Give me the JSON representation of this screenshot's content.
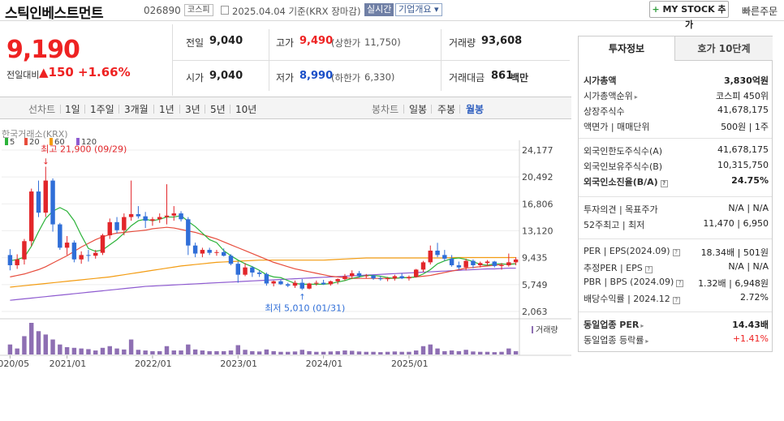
{
  "header": {
    "company_name": "스틱인베스트먼트",
    "code": "026890",
    "market": "코스피",
    "date_text": "2025.04.04 기준(KRX 장마감)",
    "realtime_label": "실시간",
    "corp_overview_label": "기업개요 ▾",
    "mystock_label": "MY STOCK 추가",
    "quick_order_label": "빠른주문"
  },
  "price": {
    "current": "9,190",
    "change_label": "전일대비",
    "change_value": "▲150",
    "change_pct": "+1.66%"
  },
  "quote": {
    "prev_close_label": "전일",
    "prev_close": "9,040",
    "high_label": "고가",
    "high": "9,490",
    "high_limit_label": "(상한가",
    "high_limit": "11,750)",
    "volume_label": "거래량",
    "volume": "93,608",
    "open_label": "시가",
    "open": "9,040",
    "low_label": "저가",
    "low": "8,990",
    "low_limit_label": "(하한가",
    "low_limit": "6,330)",
    "amount_label": "거래대금",
    "amount": "861",
    "amount_unit": "백만"
  },
  "toolbar": {
    "line_chart": "선차트",
    "ranges": [
      "1일",
      "1주일",
      "3개월",
      "1년",
      "3년",
      "5년",
      "10년"
    ],
    "candle_chart": "봉차트",
    "candle_periods": [
      "일봉",
      "주봉",
      "월봉"
    ],
    "active_period": "월봉"
  },
  "chart_data": {
    "type": "candlestick",
    "source_label": "한국거래소(KRX)",
    "moving_averages": [
      {
        "name": "5",
        "color": "#2db33a"
      },
      {
        "name": "20",
        "color": "#e74c3c"
      },
      {
        "name": "60",
        "color": "#f39c12"
      },
      {
        "name": "120",
        "color": "#8e5bd0"
      }
    ],
    "y_ticks": [
      "24,177",
      "20,492",
      "16,806",
      "13,120",
      "9,435",
      "5,749",
      "2,063"
    ],
    "ylim": [
      2063,
      24177
    ],
    "x_ticks": [
      "2020/05",
      "2021/01",
      "2022/01",
      "2023/01",
      "2024/01",
      "2025/01"
    ],
    "volume_label": "거래량",
    "annotation_high": "최고 21,900 (09/29)",
    "annotation_low": "최저 5,010 (01/31)",
    "ohlc": [
      [
        9800,
        10600,
        7700,
        8400
      ],
      [
        8400,
        9900,
        7900,
        9200
      ],
      [
        9200,
        12000,
        8500,
        11700
      ],
      [
        11700,
        18900,
        11000,
        18500
      ],
      [
        18500,
        20000,
        15000,
        15600
      ],
      [
        15600,
        21900,
        15000,
        20000
      ],
      [
        20000,
        20300,
        13000,
        14000
      ],
      [
        14000,
        14200,
        10500,
        10800
      ],
      [
        10800,
        12400,
        9800,
        11500
      ],
      [
        11500,
        11800,
        8800,
        9200
      ],
      [
        9200,
        10300,
        8600,
        9800
      ],
      [
        9800,
        10500,
        8900,
        9700
      ],
      [
        9700,
        10500,
        9300,
        10100
      ],
      [
        10100,
        12700,
        9800,
        12500
      ],
      [
        12500,
        14800,
        12000,
        14300
      ],
      [
        14300,
        15000,
        12800,
        13200
      ],
      [
        13200,
        15500,
        12500,
        15000
      ],
      [
        15000,
        20000,
        14500,
        15400
      ],
      [
        15400,
        16500,
        14800,
        15100
      ],
      [
        15100,
        15700,
        13500,
        14500
      ],
      [
        14500,
        15000,
        13800,
        14700
      ],
      [
        14700,
        15500,
        14200,
        15000
      ],
      [
        15000,
        19500,
        14000,
        15200
      ],
      [
        15200,
        16500,
        14500,
        15500
      ],
      [
        15500,
        15800,
        14400,
        14700
      ],
      [
        14700,
        15000,
        9800,
        11100
      ],
      [
        11100,
        11500,
        9500,
        10000
      ],
      [
        10000,
        10800,
        9500,
        10500
      ],
      [
        10500,
        10800,
        9800,
        10100
      ],
      [
        10100,
        10500,
        9700,
        10200
      ],
      [
        10200,
        10700,
        9600,
        9700
      ],
      [
        9700,
        9900,
        8400,
        8600
      ],
      [
        8600,
        8900,
        6000,
        7100
      ],
      [
        7100,
        8700,
        6900,
        8100
      ],
      [
        8100,
        8300,
        6800,
        7400
      ],
      [
        7400,
        7700,
        6800,
        7200
      ],
      [
        7200,
        7400,
        5600,
        5900
      ],
      [
        5900,
        6300,
        5500,
        6200
      ],
      [
        6200,
        6400,
        5700,
        5800
      ],
      [
        5800,
        6000,
        5400,
        5600
      ],
      [
        5600,
        6300,
        5300,
        6000
      ],
      [
        6000,
        6500,
        5010,
        5200
      ],
      [
        5200,
        6000,
        5100,
        5900
      ],
      [
        5900,
        6300,
        5600,
        6000
      ],
      [
        6000,
        6400,
        5700,
        5800
      ],
      [
        5800,
        6300,
        5600,
        6200
      ],
      [
        6200,
        6600,
        5800,
        6500
      ],
      [
        6500,
        7200,
        6300,
        6900
      ],
      [
        6900,
        7700,
        6500,
        7300
      ],
      [
        7300,
        7600,
        6700,
        6900
      ],
      [
        6900,
        7200,
        6600,
        7000
      ],
      [
        7000,
        7100,
        6400,
        6600
      ],
      [
        6600,
        6900,
        6300,
        6500
      ],
      [
        6500,
        6800,
        6200,
        6600
      ],
      [
        6600,
        7100,
        6300,
        6900
      ],
      [
        6900,
        7300,
        6500,
        6600
      ],
      [
        6600,
        7000,
        6300,
        6800
      ],
      [
        6800,
        7900,
        6700,
        7800
      ],
      [
        7800,
        9000,
        7500,
        8800
      ],
      [
        8800,
        11100,
        8500,
        10400
      ],
      [
        10400,
        11470,
        9500,
        9800
      ],
      [
        9800,
        10500,
        9000,
        9300
      ],
      [
        9300,
        9800,
        8200,
        8400
      ],
      [
        8400,
        8900,
        7800,
        8100
      ],
      [
        8100,
        9300,
        7700,
        9000
      ],
      [
        9000,
        9200,
        8000,
        8400
      ],
      [
        8400,
        8900,
        8100,
        8700
      ],
      [
        8700,
        9100,
        8300,
        8900
      ],
      [
        8900,
        9000,
        8100,
        8300
      ],
      [
        8300,
        8700,
        7800,
        8400
      ],
      [
        8400,
        10000,
        8200,
        8800
      ],
      [
        8800,
        9490,
        8400,
        9190
      ]
    ],
    "ma5": [
      9000,
      9200,
      9500,
      11000,
      13000,
      14800,
      15800,
      16300,
      15800,
      14500,
      12500,
      10700,
      10300,
      10500,
      11200,
      11900,
      12800,
      13800,
      14500,
      14700,
      14500,
      14700,
      15000,
      15000,
      15200,
      14400,
      13700,
      12800,
      11900,
      11500,
      10400,
      9700,
      9100,
      8600,
      8200,
      7700,
      7100,
      6800,
      6700,
      6300,
      5900,
      5800,
      5800,
      5800,
      5800,
      5900,
      6100,
      6300,
      6600,
      6800,
      7000,
      7000,
      6900,
      6700,
      6600,
      6700,
      6700,
      6800,
      7200,
      7800,
      8600,
      9000,
      9300,
      9400,
      9200,
      8900,
      8500,
      8400,
      8600,
      8600,
      8500,
      8600
    ],
    "ma20": [
      6800,
      7000,
      7200,
      7500,
      7800,
      8200,
      8700,
      9200,
      9700,
      10300,
      10900,
      11400,
      11900,
      12300,
      12600,
      12800,
      12900,
      13000,
      13100,
      13200,
      13400,
      13500,
      13600,
      13500,
      13300,
      13100,
      12900,
      12600,
      12300,
      12000,
      11600,
      11200,
      10800,
      10400,
      10000,
      9600,
      9200,
      8800,
      8500,
      8200,
      7900,
      7700,
      7500,
      7300,
      7100,
      6900,
      6800,
      6700,
      6600,
      6600,
      6600,
      6600,
      6600,
      6600,
      6600,
      6700,
      6700,
      6800,
      6900,
      7000,
      7200,
      7400,
      7600,
      7800,
      8000,
      8100,
      8200,
      8300,
      8400,
      8500,
      8600,
      8600
    ],
    "ma60": [
      5400,
      5500,
      5600,
      5700,
      5800,
      5900,
      6000,
      6100,
      6200,
      6300,
      6400,
      6500,
      6600,
      6700,
      6800,
      6950,
      7100,
      7250,
      7400,
      7550,
      7700,
      7850,
      8000,
      8150,
      8300,
      8400,
      8500,
      8600,
      8700,
      8800,
      8850,
      8900,
      8950,
      9000,
      9050,
      9100,
      9100,
      9100,
      9100,
      9100,
      9100,
      9100,
      9100,
      9100,
      9100,
      9150,
      9200,
      9250,
      9300,
      9350,
      9400,
      9400,
      9400,
      9400,
      9400,
      9400,
      9400,
      9400,
      9400,
      9400,
      9400,
      9400,
      9450,
      9450,
      9450,
      9450,
      9450,
      9450,
      9450,
      9450,
      9450,
      9450
    ],
    "ma120": [
      3600,
      3700,
      3800,
      3900,
      4000,
      4100,
      4200,
      4300,
      4400,
      4500,
      4600,
      4700,
      4800,
      4900,
      5000,
      5100,
      5200,
      5300,
      5400,
      5500,
      5550,
      5600,
      5650,
      5700,
      5750,
      5800,
      5850,
      5900,
      5950,
      6000,
      6050,
      6100,
      6150,
      6200,
      6250,
      6300,
      6350,
      6400,
      6450,
      6500,
      6550,
      6600,
      6650,
      6700,
      6750,
      6800,
      6850,
      6900,
      6950,
      7000,
      7050,
      7100,
      7150,
      7200,
      7250,
      7300,
      7350,
      7400,
      7450,
      7500,
      7550,
      7600,
      7650,
      7700,
      7750,
      7800,
      7850,
      7900,
      7900,
      7950,
      8000,
      8000
    ],
    "volume": [
      30,
      18,
      55,
      95,
      70,
      60,
      45,
      30,
      22,
      20,
      18,
      16,
      12,
      20,
      25,
      18,
      15,
      45,
      14,
      12,
      10,
      10,
      25,
      12,
      12,
      30,
      15,
      12,
      10,
      10,
      10,
      12,
      28,
      14,
      10,
      9,
      15,
      10,
      8,
      8,
      9,
      14,
      10,
      8,
      8,
      9,
      10,
      12,
      11,
      9,
      8,
      8,
      7,
      8,
      9,
      8,
      8,
      12,
      25,
      30,
      18,
      10,
      12,
      10,
      14,
      9,
      8,
      8,
      7,
      8,
      18,
      10
    ]
  },
  "right_panel": {
    "tab_active": "투자정보",
    "tab_inactive": "호가 10단계",
    "rows1": [
      {
        "label": "시가총액",
        "value": "3,830억원",
        "bold": true
      },
      {
        "label": "시가총액순위",
        "value": "코스피 450위",
        "arrow": true
      },
      {
        "label": "상장주식수",
        "value": "41,678,175"
      },
      {
        "label": "액면가 | 매매단위",
        "value": "500원  |  1주"
      }
    ],
    "rows2": [
      {
        "label": "외국인한도주식수(A)",
        "value": "41,678,175"
      },
      {
        "label": "외국인보유주식수(B)",
        "value": "10,315,750"
      },
      {
        "label": "외국인소진율(B/A)",
        "value": "24.75%",
        "bold": true,
        "icon": true
      }
    ],
    "rows3": [
      {
        "label": "투자의견 | 목표주가",
        "value": "N/A  |  N/A"
      },
      {
        "label": "52주최고 | 최저",
        "value": "11,470  |  6,950"
      }
    ],
    "rows4": [
      {
        "label": "PER | EPS(2024.09)",
        "value": "18.34배  |  501원",
        "icon": true
      },
      {
        "label": "추정PER | EPS",
        "value": "N/A  |  N/A",
        "icon": true
      },
      {
        "label": "PBR | BPS (2024.09)",
        "value": "1.32배  |  6,948원",
        "icon": true
      },
      {
        "label": "배당수익률 | 2024.12",
        "value": "2.72%",
        "icon": true
      }
    ],
    "rows5": [
      {
        "label": "동일업종 PER",
        "value": "14.43배",
        "bold": true,
        "arrow": true
      },
      {
        "label": "동일업종 등락률",
        "value": "+1.41%",
        "red": true,
        "arrow": true
      }
    ]
  }
}
